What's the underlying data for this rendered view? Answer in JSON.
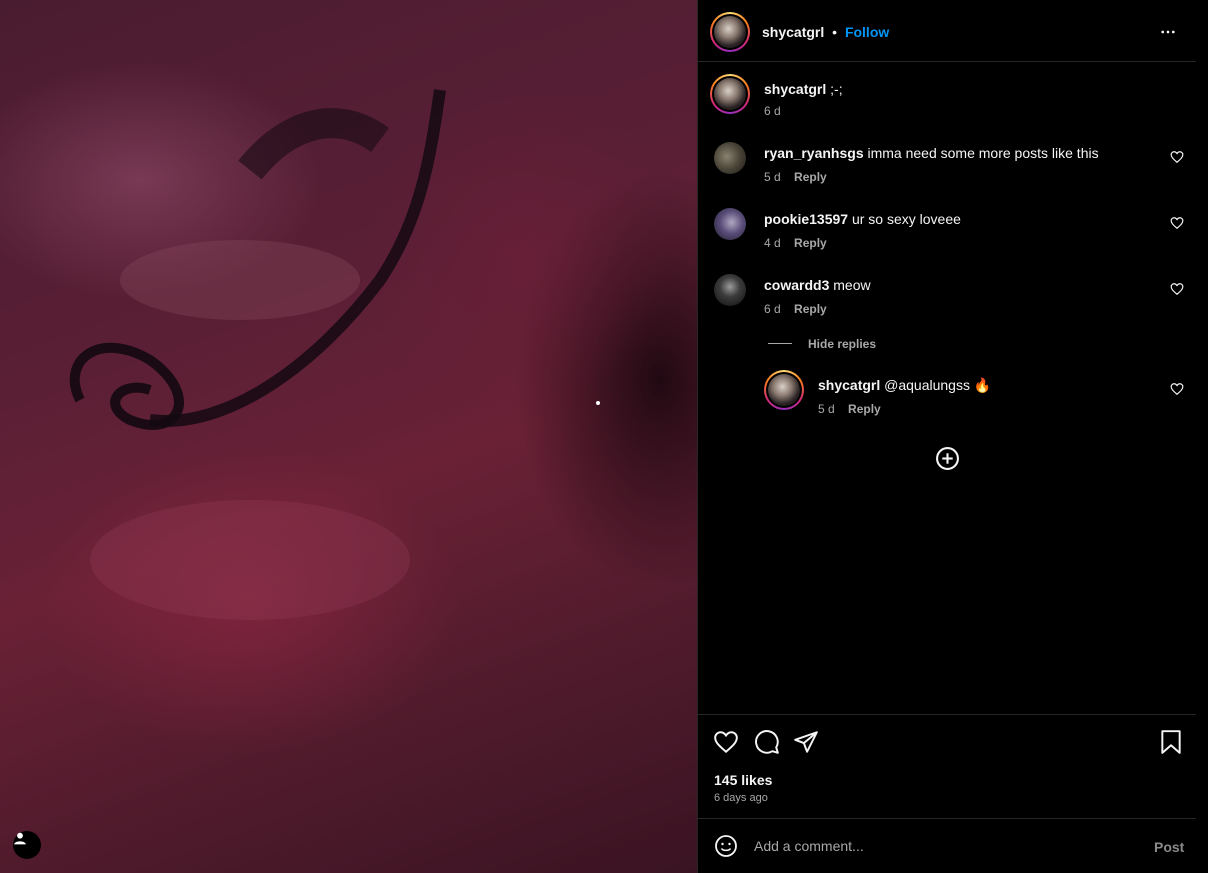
{
  "post": {
    "author": "shycatgrl",
    "separator": "•",
    "follow_label": "Follow",
    "caption": ";-;",
    "caption_age": "6 d",
    "likes": "145 likes",
    "age": "6 days ago"
  },
  "comments": [
    {
      "user": "ryan_ryanhsgs",
      "text": "imma need some more posts like this",
      "age": "5 d",
      "reply": "Reply"
    },
    {
      "user": "pookie13597",
      "text": "ur so sexy loveee",
      "age": "4 d",
      "reply": "Reply"
    },
    {
      "user": "cowardd3",
      "text": "meow",
      "age": "6 d",
      "reply": "Reply"
    }
  ],
  "thread": {
    "hide_label": "Hide replies",
    "reply": {
      "user": "shycatgrl",
      "text": "@aqualungss 🔥",
      "age": "5 d",
      "reply": "Reply"
    }
  },
  "composer": {
    "placeholder": "Add a comment...",
    "post_label": "Post"
  },
  "colors": {
    "accent": "#0095f6",
    "secondary_text": "#a8a8a8",
    "divider": "#262626"
  },
  "icons": [
    "more-options-icon",
    "heart-icon",
    "comment-icon",
    "share-icon",
    "bookmark-icon",
    "add-circle-icon",
    "emoji-icon",
    "user-tag-icon"
  ]
}
